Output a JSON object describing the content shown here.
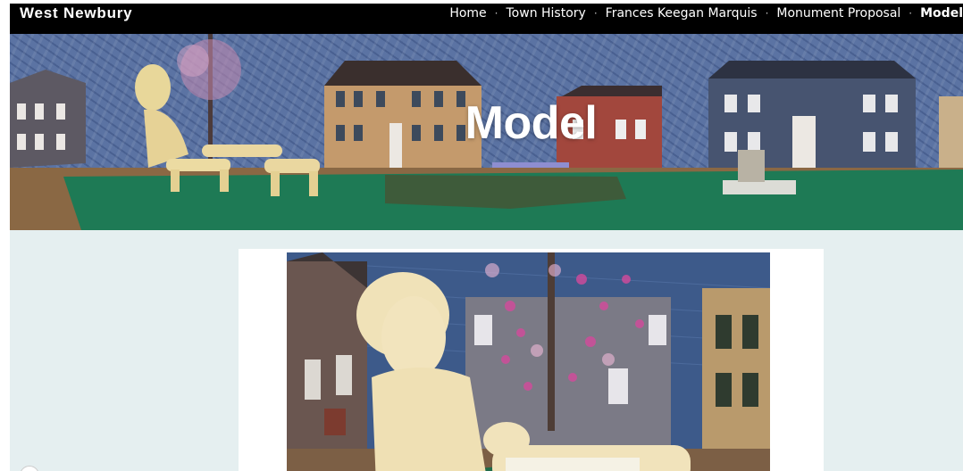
{
  "site": {
    "title": "West Newbury"
  },
  "nav": {
    "items": [
      {
        "label": "Home",
        "active": false
      },
      {
        "label": "Town History",
        "active": false
      },
      {
        "label": "Frances Keegan Marquis",
        "active": false
      },
      {
        "label": "Monument Proposal",
        "active": false
      },
      {
        "label": "Model",
        "active": true
      }
    ],
    "separator": "·"
  },
  "hero": {
    "title": "Model"
  },
  "colors": {
    "navbar": "#000000",
    "page_bg": "#e5eff0",
    "accent": "#8e8ed0"
  }
}
